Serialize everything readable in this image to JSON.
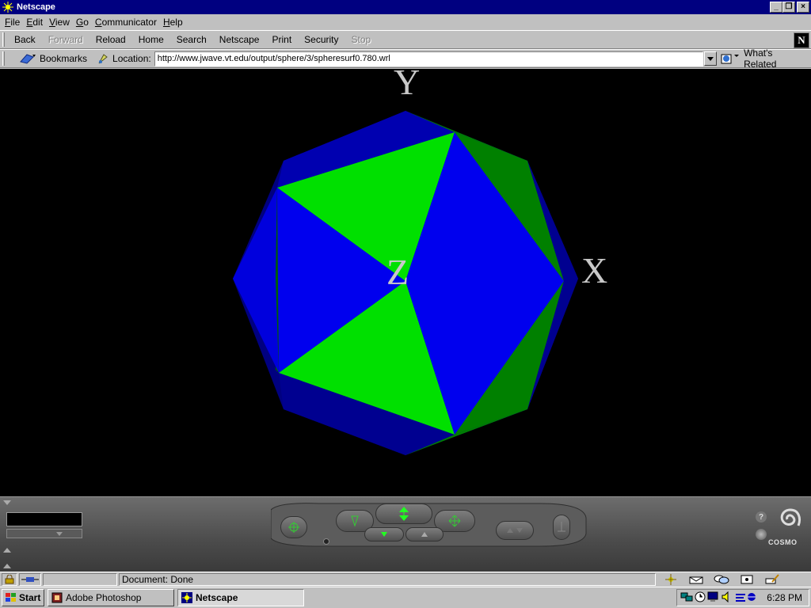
{
  "window": {
    "title": "Netscape"
  },
  "window_buttons": {
    "minimize": "_",
    "maximize": "❐",
    "close": "×"
  },
  "menu": [
    {
      "accel": "F",
      "rest": "ile"
    },
    {
      "accel": "E",
      "rest": "dit"
    },
    {
      "accel": "V",
      "rest": "iew"
    },
    {
      "accel": "G",
      "rest": "o"
    },
    {
      "accel": "C",
      "rest": "ommunicator"
    },
    {
      "accel": "H",
      "rest": "elp"
    }
  ],
  "navbar": {
    "back": "Back",
    "forward": "Forward",
    "reload": "Reload",
    "home": "Home",
    "search": "Search",
    "netscape": "Netscape",
    "print": "Print",
    "security": "Security",
    "stop": "Stop",
    "logo_letter": "N"
  },
  "locbar": {
    "bookmarks": "Bookmarks",
    "location_label": "Location:",
    "url": "http://www.jwave.vt.edu/output/sphere/3/spheresurf0.780.wrl",
    "whats_related": "What's Related"
  },
  "scene": {
    "axis_y": "Y",
    "axis_x": "X",
    "axis_z": "Z",
    "colors": {
      "background": "#000000",
      "blue": "#0000ee",
      "light_green": "#00e000",
      "dark_green": "#008000",
      "dark_blue": "#000080"
    }
  },
  "dashboard": {
    "brand": "COSMO",
    "help": "?"
  },
  "status": {
    "text": "Document: Done"
  },
  "taskbar": {
    "start": "Start",
    "tasks": [
      "Adobe Photoshop",
      "Netscape"
    ],
    "clock": "6:28 PM"
  }
}
